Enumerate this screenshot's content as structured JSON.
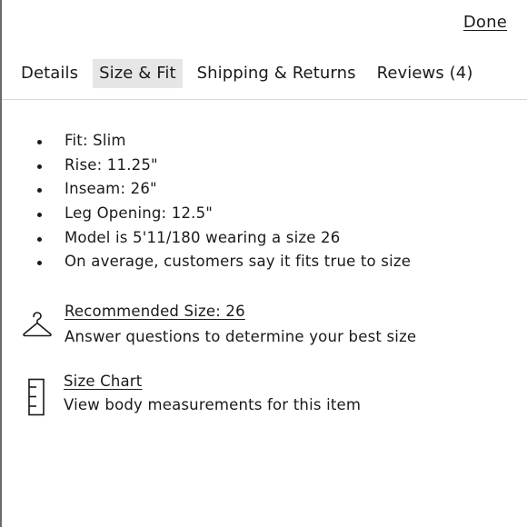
{
  "header": {
    "done_label": "Done"
  },
  "tabs": [
    {
      "label": "Details",
      "active": false
    },
    {
      "label": "Size & Fit",
      "active": true
    },
    {
      "label": "Shipping & Returns",
      "active": false
    },
    {
      "label": "Reviews (4)",
      "active": false
    }
  ],
  "fit_details": [
    "Fit: Slim",
    "Rise: 11.25\"",
    "Inseam: 26\"",
    "Leg Opening: 12.5\"",
    "Model is 5'11/180 wearing a size 26",
    "On average, customers say it fits true to size"
  ],
  "recommended": {
    "icon": "hanger-icon",
    "title": "Recommended Size: 26",
    "subtitle": "Answer questions to determine your best size"
  },
  "size_chart": {
    "icon": "ruler-icon",
    "title": "Size Chart",
    "subtitle": "View body measurements for this item"
  },
  "colors": {
    "active_tab_bg": "#e6e6e6",
    "text": "#1a1a1a",
    "divider": "#d6d6d6"
  }
}
